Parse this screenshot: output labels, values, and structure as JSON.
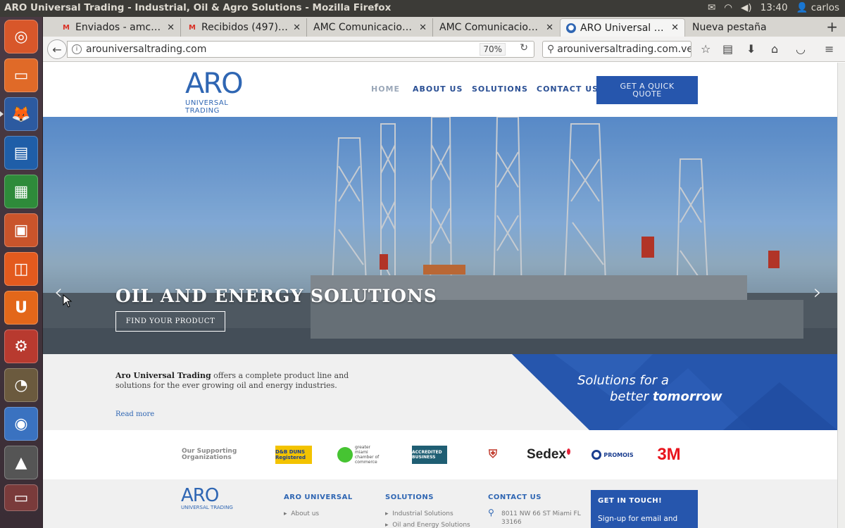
{
  "os": {
    "window_title": "ARO Universal Trading - Industrial, Oil & Agro Solutions - Mozilla Firefox",
    "clock": "13:40",
    "user": "carlos"
  },
  "browser": {
    "tabs": [
      {
        "label": "Enviados - amcco...",
        "icon": "gmail-icon"
      },
      {
        "label": "Recibidos (497) - ...",
        "icon": "gmail-icon"
      },
      {
        "label": "AMC Comunicacione...",
        "icon": "none"
      },
      {
        "label": "AMC Comunicacione...",
        "icon": "none"
      },
      {
        "label": "ARO Universal Tr...",
        "icon": "globe-icon",
        "active": true
      },
      {
        "label": "Nueva pestaña",
        "icon": "none"
      }
    ],
    "url": "arouniversaltrading.com",
    "zoom": "70%",
    "search_value": "arouniversaltrading.com.ve/"
  },
  "site": {
    "logo_main": "ARO",
    "logo_sub": "UNIVERSAL TRADING",
    "nav": [
      {
        "label": "HOME",
        "color": "#9aa7b8"
      },
      {
        "label": "ABOUT US",
        "color": "#2a4f94"
      },
      {
        "label": "SOLUTIONS",
        "color": "#2a4f94"
      },
      {
        "label": "CONTACT US",
        "color": "#2a4f94"
      }
    ],
    "quote_button": "GET A QUICK QUOTE",
    "hero": {
      "title": "OIL AND ENERGY SOLUTIONS",
      "cta": "FIND YOUR PRODUCT",
      "prev": "‹",
      "next": "›"
    },
    "intro": {
      "company": "Aro Universal Trading",
      "text": " offers a complete product line and solutions for the ever growing oil and energy industries.",
      "read_more": "Read more",
      "slogan_line1": "Solutions for a",
      "slogan_line2_light": "better ",
      "slogan_line2_bold": "tomorrow"
    },
    "partners": {
      "lead_line1": "Our Supporting",
      "lead_line2": "Organizations",
      "items": [
        "D&B DUNS Registered",
        "greater miami chamber of commerce",
        "ACCREDITED BUSINESS",
        "Chamber crest",
        "Sedex",
        "PROMOIS",
        "3M"
      ]
    },
    "footer": {
      "col1_title": "ARO UNIVERSAL",
      "col1_item": "About us",
      "col2_title": "SOLUTIONS",
      "col2_item1": "Industrial Solutions",
      "col2_item2": "Oil and Energy Solutions",
      "col3_title": "CONTACT US",
      "col3_addr1": "8011 NW 66 ST Miami FL",
      "col3_addr2": "33166",
      "newsletter_title": "GET IN TOUCH!",
      "newsletter_text": "Sign-up for email and"
    }
  }
}
